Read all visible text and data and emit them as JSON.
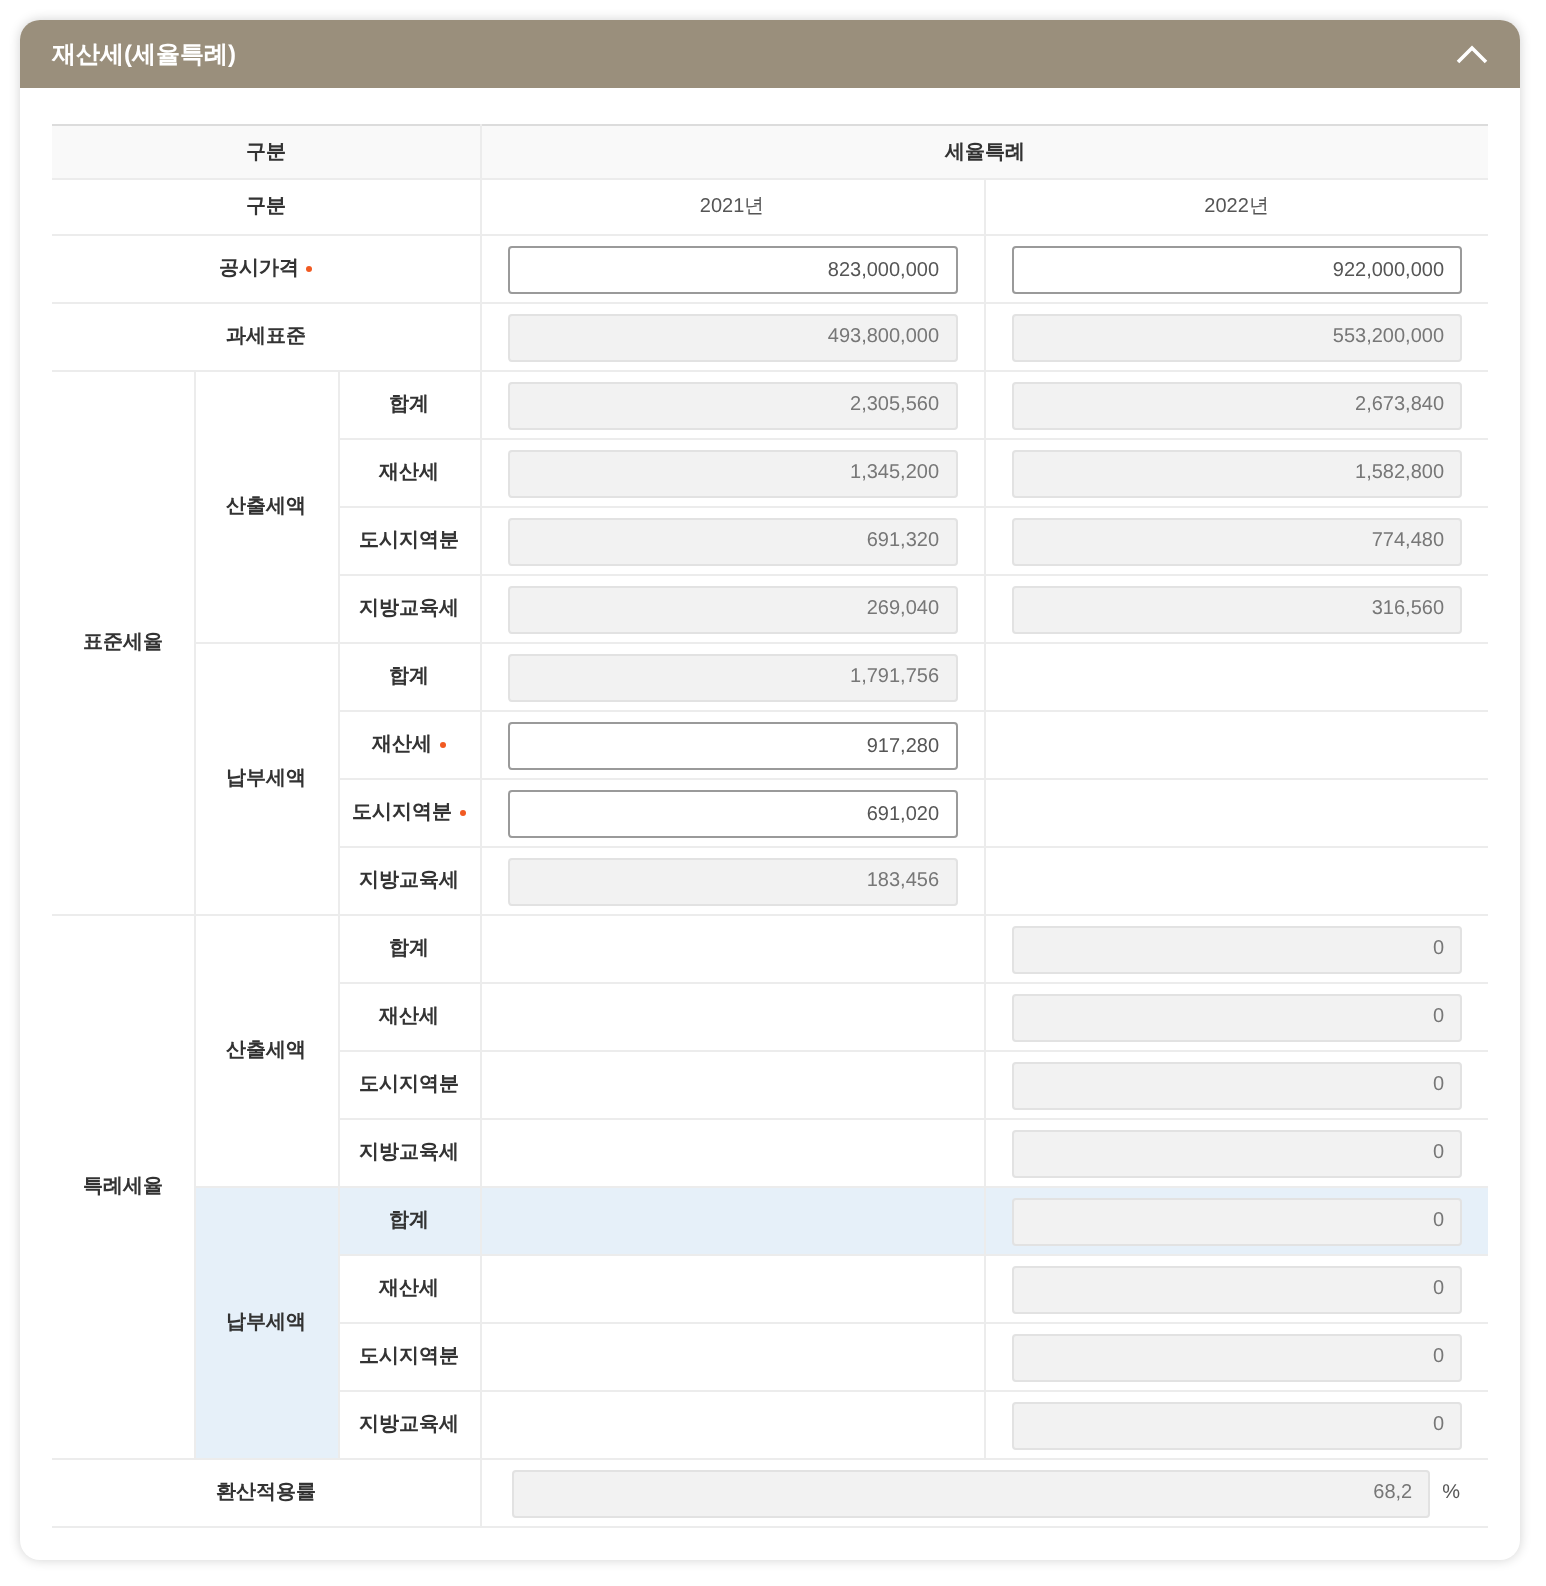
{
  "panel": {
    "title": "재산세(세율특례)",
    "expanded": true
  },
  "header": {
    "label": "구분",
    "group": "세율특례"
  },
  "year_row": {
    "label": "구분",
    "years": [
      "2021년",
      "2022년"
    ]
  },
  "rows": [
    {
      "kind": "simple",
      "label": "공시가격",
      "required": true,
      "cells": [
        {
          "kind": "input",
          "value": "823,000,000"
        },
        {
          "kind": "input",
          "value": "922,000,000"
        }
      ]
    },
    {
      "kind": "simple",
      "label": "과세표준",
      "required": false,
      "cells": [
        {
          "kind": "readonly",
          "value": "493,800,000"
        },
        {
          "kind": "readonly",
          "value": "553,200,000"
        }
      ]
    },
    {
      "kind": "group",
      "label": "표준세율",
      "subgroups": [
        {
          "label": "산출세액",
          "highlighted": false,
          "rows": [
            {
              "label": "합계",
              "required": false,
              "highlighted": false,
              "cells": [
                {
                  "kind": "readonly",
                  "value": "2,305,560"
                },
                {
                  "kind": "readonly",
                  "value": "2,673,840"
                }
              ]
            },
            {
              "label": "재산세",
              "required": false,
              "highlighted": false,
              "cells": [
                {
                  "kind": "readonly",
                  "value": "1,345,200"
                },
                {
                  "kind": "readonly",
                  "value": "1,582,800"
                }
              ]
            },
            {
              "label": "도시지역분",
              "required": false,
              "highlighted": false,
              "cells": [
                {
                  "kind": "readonly",
                  "value": "691,320"
                },
                {
                  "kind": "readonly",
                  "value": "774,480"
                }
              ]
            },
            {
              "label": "지방교육세",
              "required": false,
              "highlighted": false,
              "cells": [
                {
                  "kind": "readonly",
                  "value": "269,040"
                },
                {
                  "kind": "readonly",
                  "value": "316,560"
                }
              ]
            }
          ]
        },
        {
          "label": "납부세액",
          "highlighted": false,
          "rows": [
            {
              "label": "합계",
              "required": false,
              "highlighted": false,
              "cells": [
                {
                  "kind": "readonly",
                  "value": "1,791,756"
                },
                {
                  "kind": "empty"
                }
              ]
            },
            {
              "label": "재산세",
              "required": true,
              "highlighted": false,
              "cells": [
                {
                  "kind": "input",
                  "value": "917,280"
                },
                {
                  "kind": "empty"
                }
              ]
            },
            {
              "label": "도시지역분",
              "required": true,
              "highlighted": false,
              "cells": [
                {
                  "kind": "input",
                  "value": "691,020"
                },
                {
                  "kind": "empty"
                }
              ]
            },
            {
              "label": "지방교육세",
              "required": false,
              "highlighted": false,
              "cells": [
                {
                  "kind": "readonly",
                  "value": "183,456"
                },
                {
                  "kind": "empty"
                }
              ]
            }
          ]
        }
      ]
    },
    {
      "kind": "group",
      "label": "특례세율",
      "subgroups": [
        {
          "label": "산출세액",
          "highlighted": false,
          "rows": [
            {
              "label": "합계",
              "required": false,
              "highlighted": false,
              "cells": [
                {
                  "kind": "empty"
                },
                {
                  "kind": "readonly",
                  "value": "0"
                }
              ]
            },
            {
              "label": "재산세",
              "required": false,
              "highlighted": false,
              "cells": [
                {
                  "kind": "empty"
                },
                {
                  "kind": "readonly",
                  "value": "0"
                }
              ]
            },
            {
              "label": "도시지역분",
              "required": false,
              "highlighted": false,
              "cells": [
                {
                  "kind": "empty"
                },
                {
                  "kind": "readonly",
                  "value": "0"
                }
              ]
            },
            {
              "label": "지방교육세",
              "required": false,
              "highlighted": false,
              "cells": [
                {
                  "kind": "empty"
                },
                {
                  "kind": "readonly",
                  "value": "0"
                }
              ]
            }
          ]
        },
        {
          "label": "납부세액",
          "highlighted": true,
          "rows": [
            {
              "label": "합계",
              "required": false,
              "highlighted": true,
              "cells": [
                {
                  "kind": "empty"
                },
                {
                  "kind": "readonly",
                  "value": "0"
                }
              ]
            },
            {
              "label": "재산세",
              "required": false,
              "highlighted": false,
              "cells": [
                {
                  "kind": "empty"
                },
                {
                  "kind": "readonly",
                  "value": "0"
                }
              ]
            },
            {
              "label": "도시지역분",
              "required": false,
              "highlighted": false,
              "cells": [
                {
                  "kind": "empty"
                },
                {
                  "kind": "readonly",
                  "value": "0"
                }
              ]
            },
            {
              "label": "지방교육세",
              "required": false,
              "highlighted": false,
              "cells": [
                {
                  "kind": "empty"
                },
                {
                  "kind": "readonly",
                  "value": "0"
                }
              ]
            }
          ]
        }
      ]
    },
    {
      "kind": "rate",
      "label": "환산적용률",
      "value": "68,2",
      "unit": "%"
    }
  ]
}
